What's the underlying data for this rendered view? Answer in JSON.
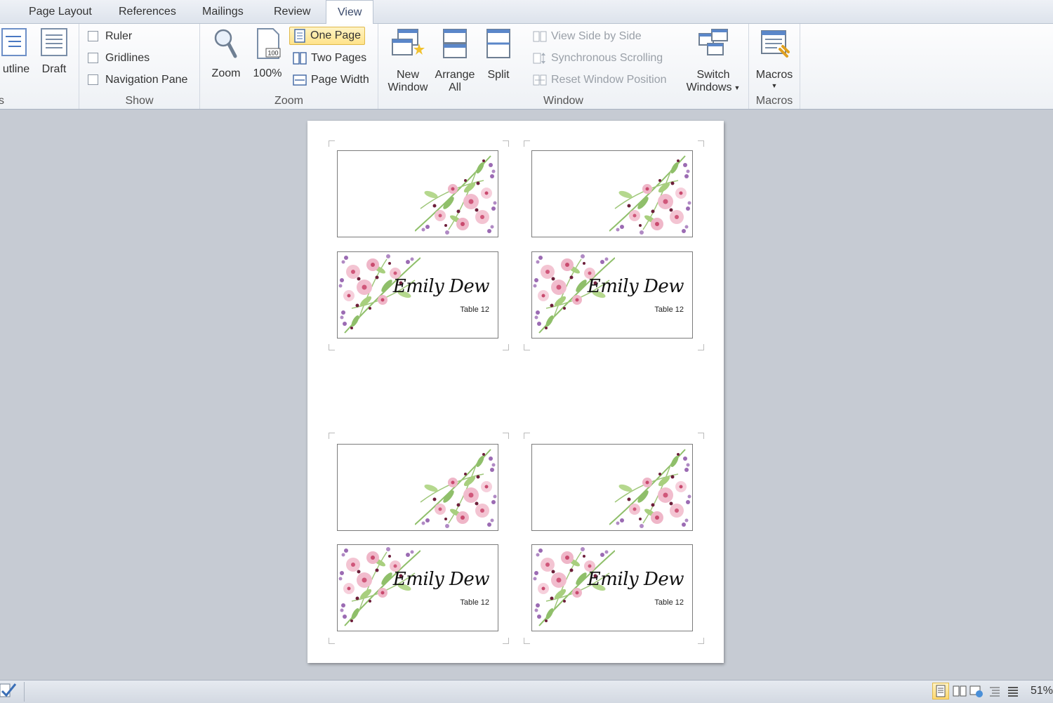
{
  "tabs": [
    {
      "label": "Page Layout"
    },
    {
      "label": "References"
    },
    {
      "label": "Mailings"
    },
    {
      "label": "Review"
    },
    {
      "label": "View"
    }
  ],
  "ribbon": {
    "views": {
      "outline_label": "utline",
      "draft_label": "Draft",
      "group_label": "s"
    },
    "show": {
      "ruler": "Ruler",
      "gridlines": "Gridlines",
      "navigation_pane": "Navigation Pane",
      "group_label": "Show"
    },
    "zoom": {
      "zoom_label": "Zoom",
      "percent_label": "100%",
      "percent_icon_text": "100",
      "one_page": "One Page",
      "two_pages": "Two Pages",
      "page_width": "Page Width",
      "group_label": "Zoom"
    },
    "window": {
      "new_window_line1": "New",
      "new_window_line2": "Window",
      "arrange_line1": "Arrange",
      "arrange_line2": "All",
      "split_label": "Split",
      "view_side_by_side": "View Side by Side",
      "sync_scrolling": "Synchronous Scrolling",
      "reset_window": "Reset Window Position",
      "switch_line1": "Switch",
      "switch_line2": "Windows",
      "group_label": "Window"
    },
    "macros": {
      "label": "Macros",
      "group_label": "Macros"
    }
  },
  "cards": {
    "name": "Emily Dew",
    "table": "Table 12"
  },
  "status": {
    "zoom": "51%"
  },
  "colors": {
    "flower_pink": "#e6a3b8",
    "flower_purple": "#9b6bb3",
    "leaf_green": "#8fbf6a",
    "berry": "#6d1f3a",
    "selected": "#ffe38a"
  }
}
